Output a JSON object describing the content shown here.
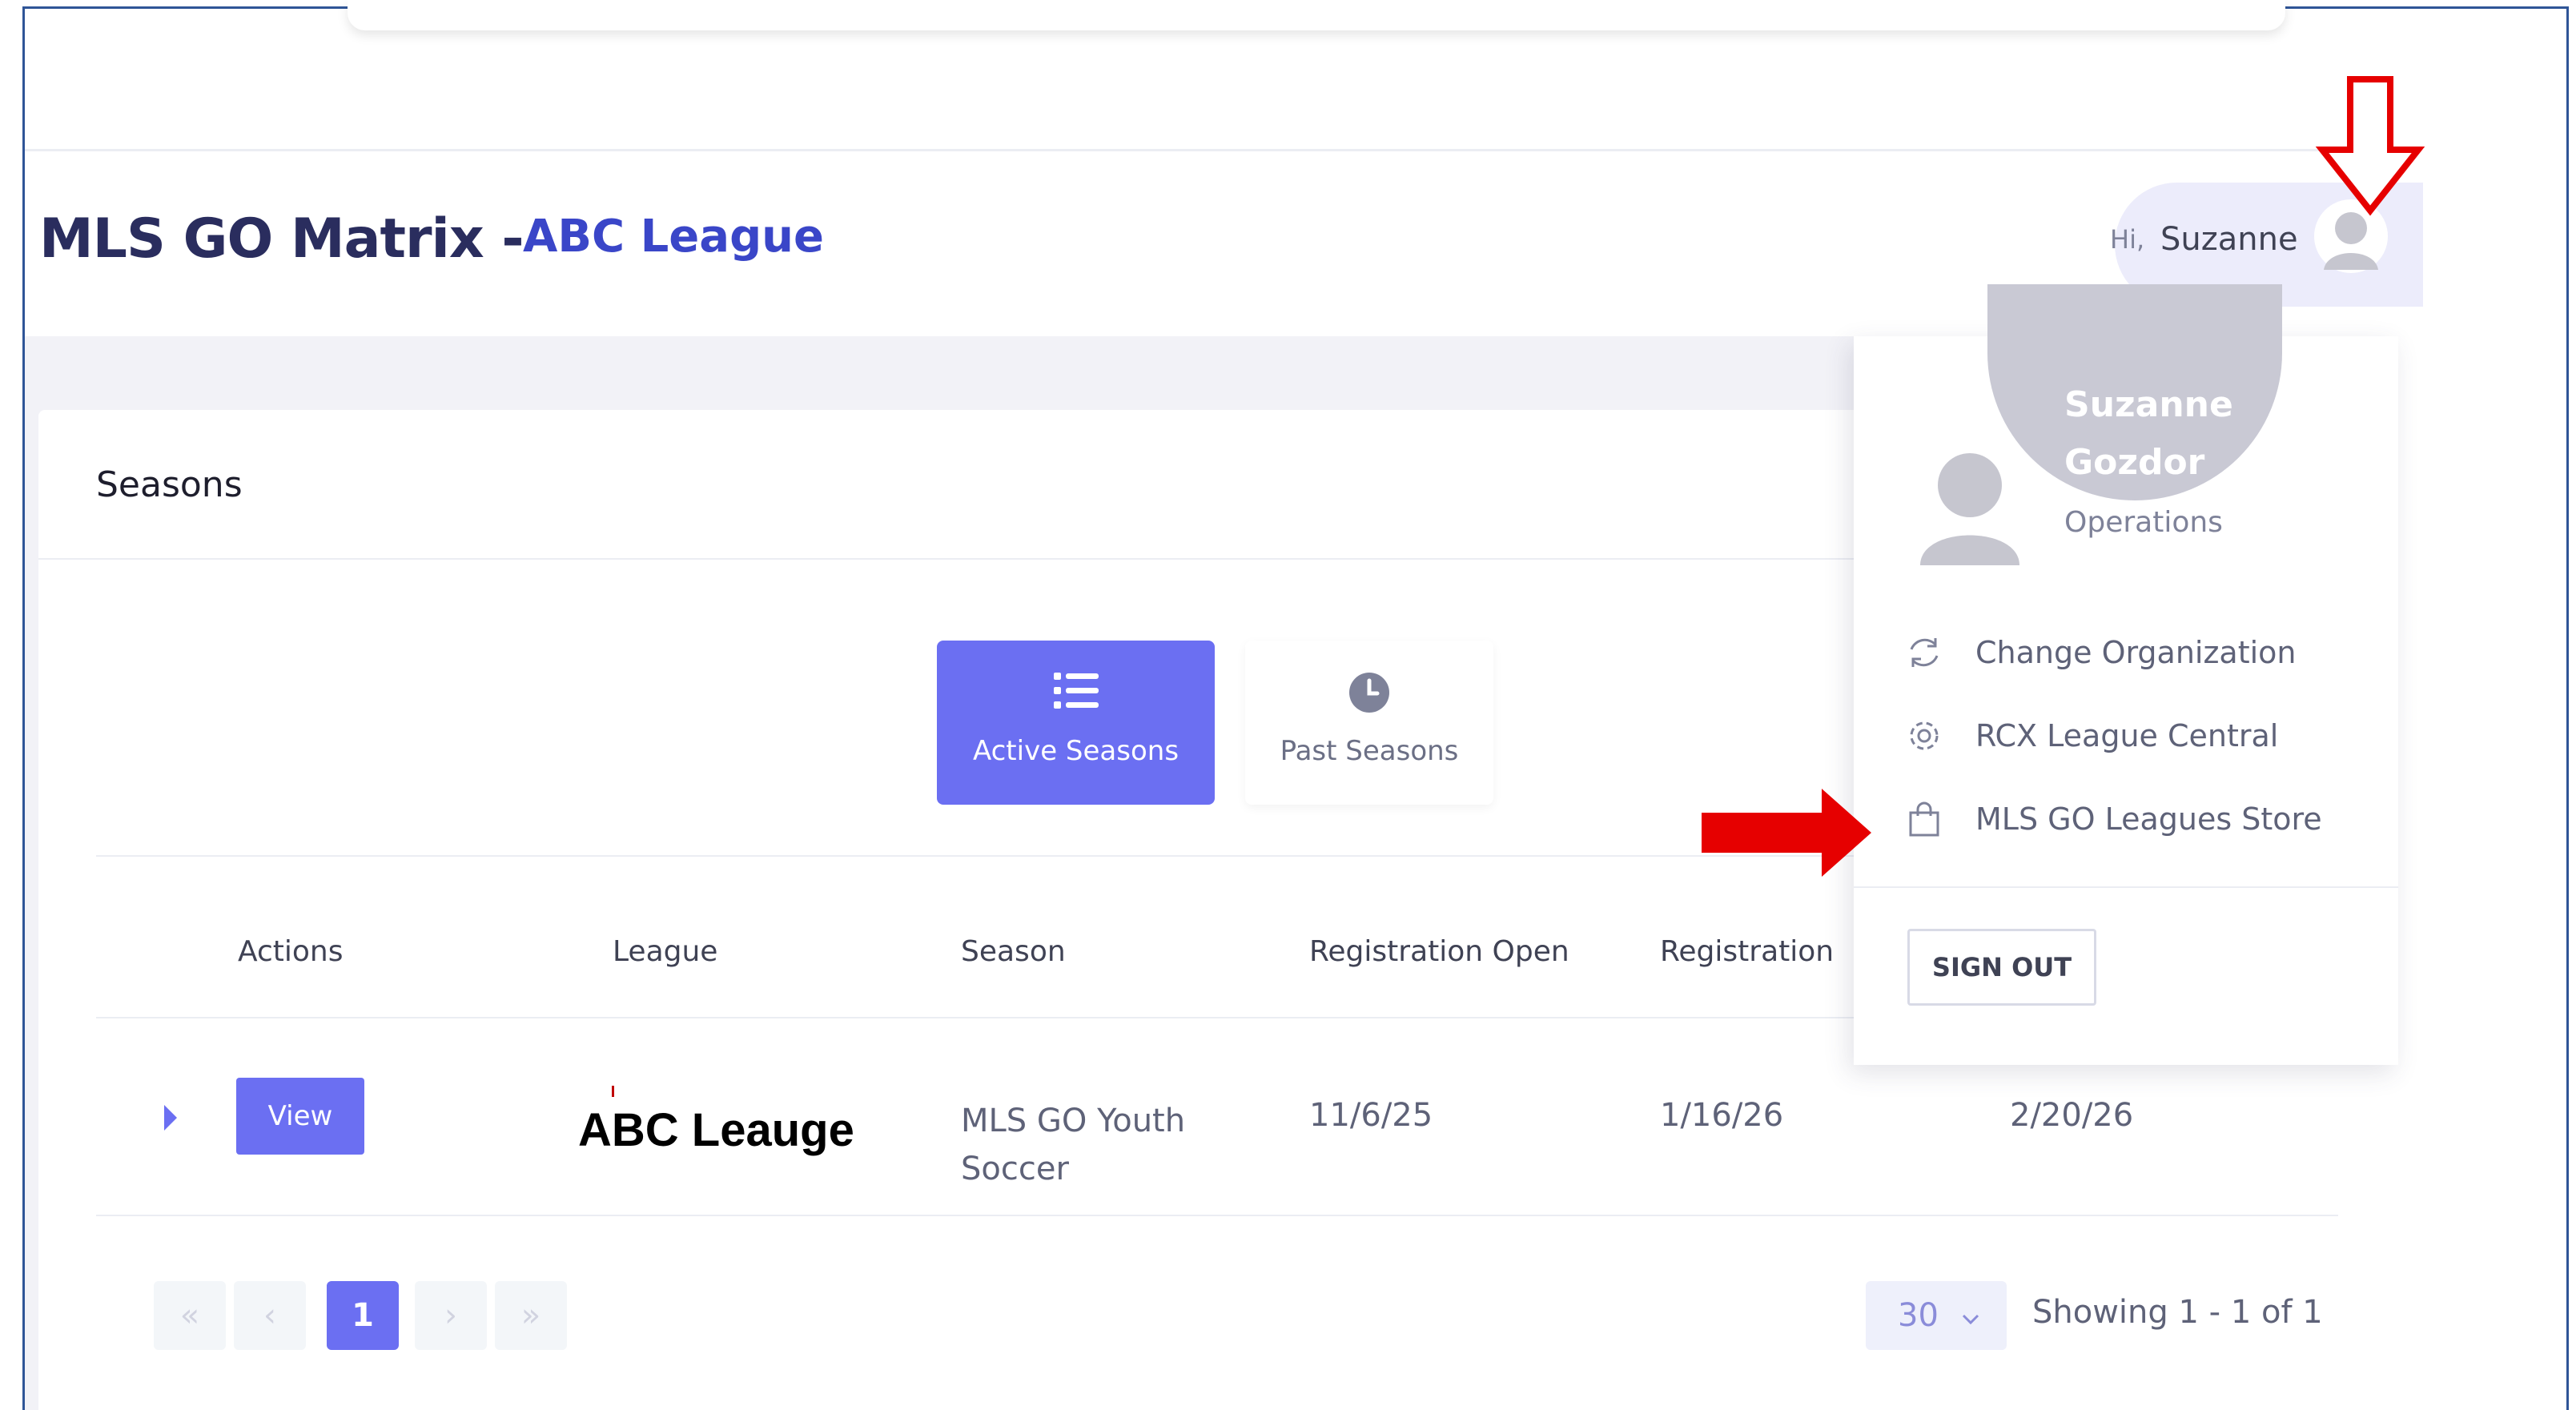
{
  "header": {
    "app_title": "MLS GO Matrix -",
    "league_title": "ABC League"
  },
  "user_chip": {
    "greeting": "Hi,",
    "name": "Suzanne"
  },
  "user_menu": {
    "full_name_line1": "Suzanne",
    "full_name_line2": "Gozdor",
    "role": "Operations",
    "items": [
      {
        "label": "Change Organization",
        "icon": "refresh-icon"
      },
      {
        "label": "RCX League Central",
        "icon": "gear-icon"
      },
      {
        "label": "MLS GO Leagues Store",
        "icon": "shopping-bag-icon"
      }
    ],
    "sign_out_label": "SIGN OUT"
  },
  "seasons": {
    "title": "Seasons",
    "tabs": [
      {
        "label": "Active Seasons",
        "icon": "list-icon",
        "active": true
      },
      {
        "label": "Past Seasons",
        "icon": "clock-icon",
        "active": false
      }
    ],
    "columns": [
      "Actions",
      "League",
      "Season",
      "Registration Open",
      "Registration"
    ],
    "rows": [
      {
        "action_label": "View",
        "league_logo_text": "ABC Leauge",
        "season_line1": "MLS GO Youth",
        "season_line2": "Soccer",
        "registration_open": "11/6/25",
        "registration_close": "1/16/26",
        "extra_date": "2/20/26"
      }
    ]
  },
  "pagination": {
    "first": "«",
    "prev": "‹",
    "current_page": "1",
    "next": "›",
    "last": "»",
    "page_size": "30",
    "showing_text": "Showing 1 - 1 of 1"
  },
  "colors": {
    "accent": "#6b6ff2",
    "title": "#2a2d5e",
    "league_title": "#3a46c8",
    "annotation": "#e60000"
  }
}
